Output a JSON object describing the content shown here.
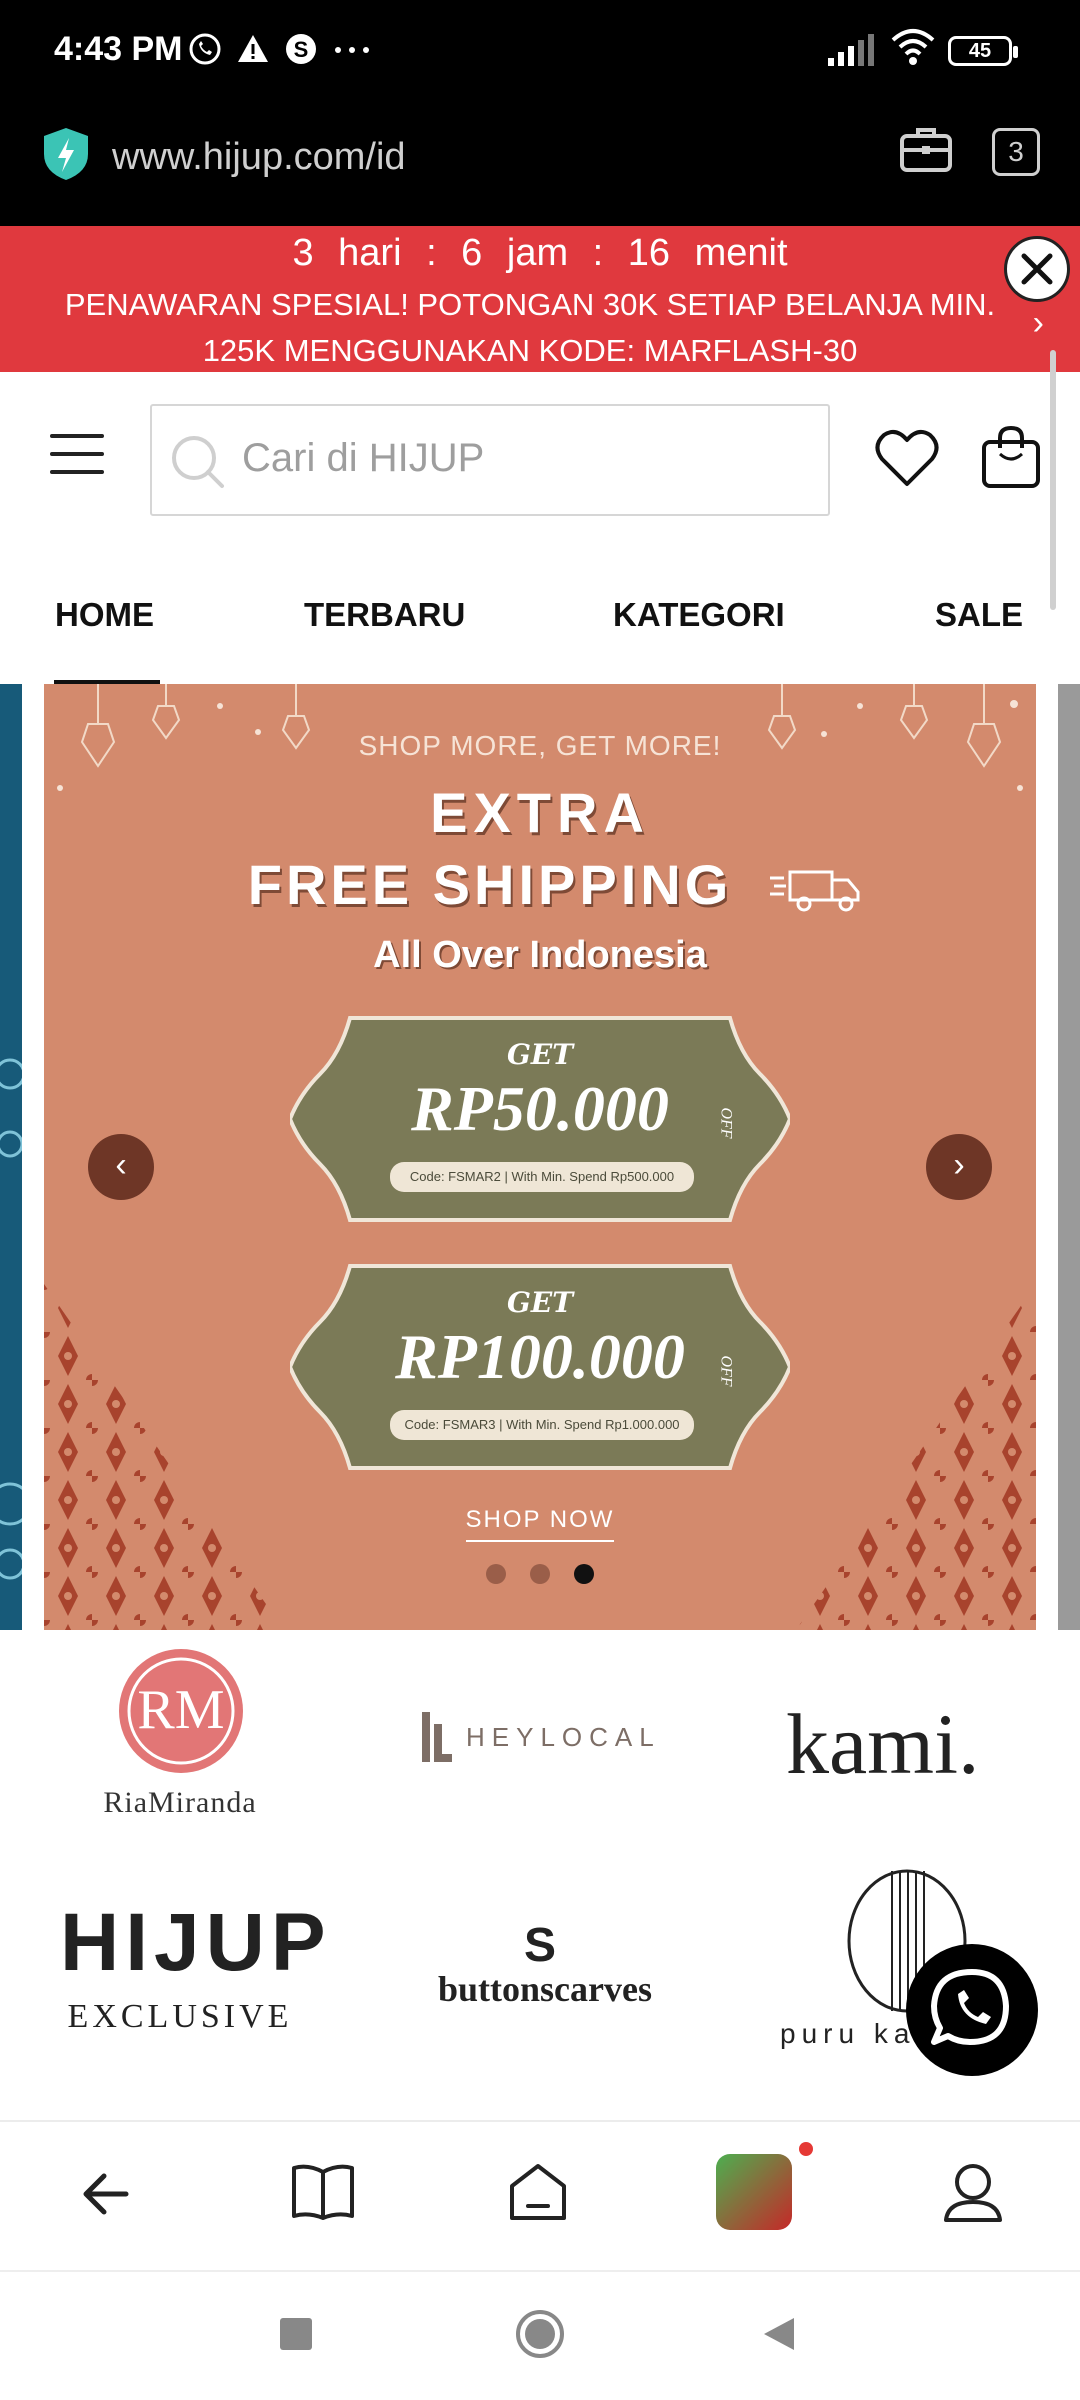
{
  "status_bar": {
    "time": "4:43 PM",
    "battery": "45"
  },
  "browser": {
    "url": "www.hijup.com/id",
    "tab_count": "3"
  },
  "promo": {
    "countdown": "3 hari : 6 jam : 16 menit",
    "message": "PENAWARAN SPESIAL! POTONGAN 30K SETIAP BELANJA MIN. 125K MENGGUNAKAN KODE: MARFLASH-30",
    "background_color": "#e0393e"
  },
  "header": {
    "search_placeholder": "Cari di HIJUP"
  },
  "nav_tabs": [
    {
      "label": "HOME",
      "active": true
    },
    {
      "label": "TERBARU",
      "active": false
    },
    {
      "label": "KATEGORI",
      "active": false
    },
    {
      "label": "SALE",
      "active": false
    }
  ],
  "banner": {
    "kicker": "SHOP MORE, GET MORE!",
    "line1": "EXTRA",
    "line2": "FREE SHIPPING",
    "line3": "All Over Indonesia",
    "offers": [
      {
        "get": "GET",
        "amount": "RP50.000",
        "off": "OFF",
        "code": "Code: FSMAR2 | With Min. Spend Rp500.000"
      },
      {
        "get": "GET",
        "amount": "RP100.000",
        "off": "OFF",
        "code": "Code: FSMAR3 | With Min. Spend Rp1.000.000"
      }
    ],
    "cta": "SHOP NOW",
    "slide_count": 3,
    "active_slide": 3,
    "background_color": "#d38a6d"
  },
  "brands": {
    "riamiranda": "RiaMiranda",
    "heylocal": "HEYLOCAL",
    "kami": "kami.",
    "hijup_top": "HIJUP",
    "hijup_bottom": "EXCLUSIVE",
    "buttonscarves": "buttonscarves",
    "purukambera": "puru ka"
  }
}
